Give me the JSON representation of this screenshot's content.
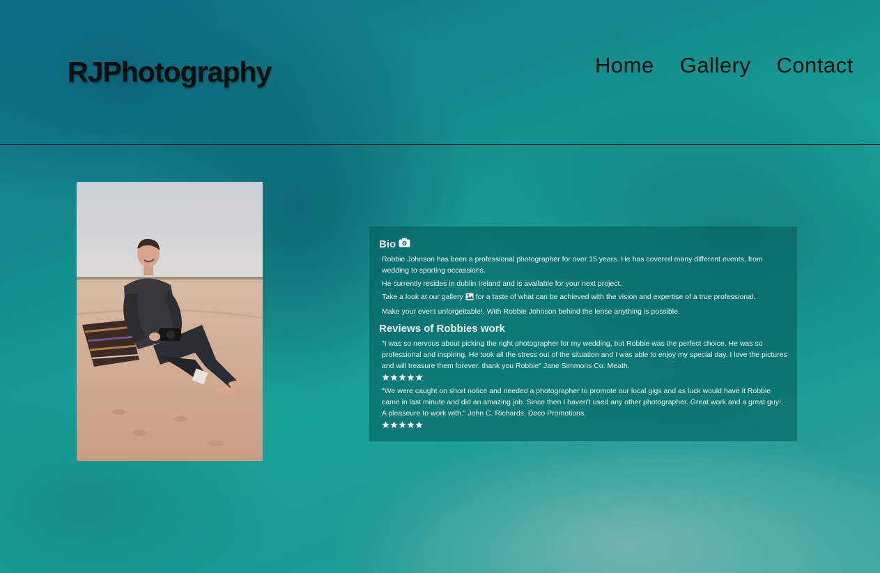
{
  "site": {
    "logo": "RJPhotography"
  },
  "nav": {
    "items": [
      {
        "label": "Home"
      },
      {
        "label": "Gallery"
      },
      {
        "label": "Contact"
      }
    ]
  },
  "bio": {
    "heading": "Bio",
    "heading_icon": "camera-icon",
    "paragraphs": {
      "p1": "Robbie Johnson has been a professional photographer for over 15 years. He has covered many different events, from wedding to sporting occassions.",
      "p2": "He currently resides in dublin Ireland and is available for your next project.",
      "p3_before": "Take a look at our gallery",
      "p3_after": "for a taste of what can be achieved with the vision and expertise of a true professional.",
      "p4": "Make your event unforgettable!. With Robbie Johnson behind the lense anything is possible."
    }
  },
  "reviews": {
    "heading": "Reviews of Robbies work",
    "items": [
      {
        "text": "\"I was so nervous about picking the right photographer for my wedding, but Robbie was the perfect choice. He was so professional and inspiring. He took all the stress out of the situation and I was able to enjoy my special day. I love the pictures and will treasure them forever. thank you Robbie\" Jane Simmons Co. Meath.",
        "rating": 5
      },
      {
        "text": "\"We were caught on short notice and needed a photographer to promote our local gigs and as luck would have it Robbie came in last minute and did an amazing job. Since then I haven't used any other photographer. Great work and a great guy!. A pleaseure to work with.\" John C. Richards, Deco Promotions.",
        "rating": 5
      }
    ]
  },
  "colors": {
    "text_dark": "#0b0f10",
    "card_bg": "rgba(0,90,90,0.55)",
    "card_text": "#f3f6f2"
  },
  "images": {
    "portrait": "photographer-portrait-on-beach"
  }
}
